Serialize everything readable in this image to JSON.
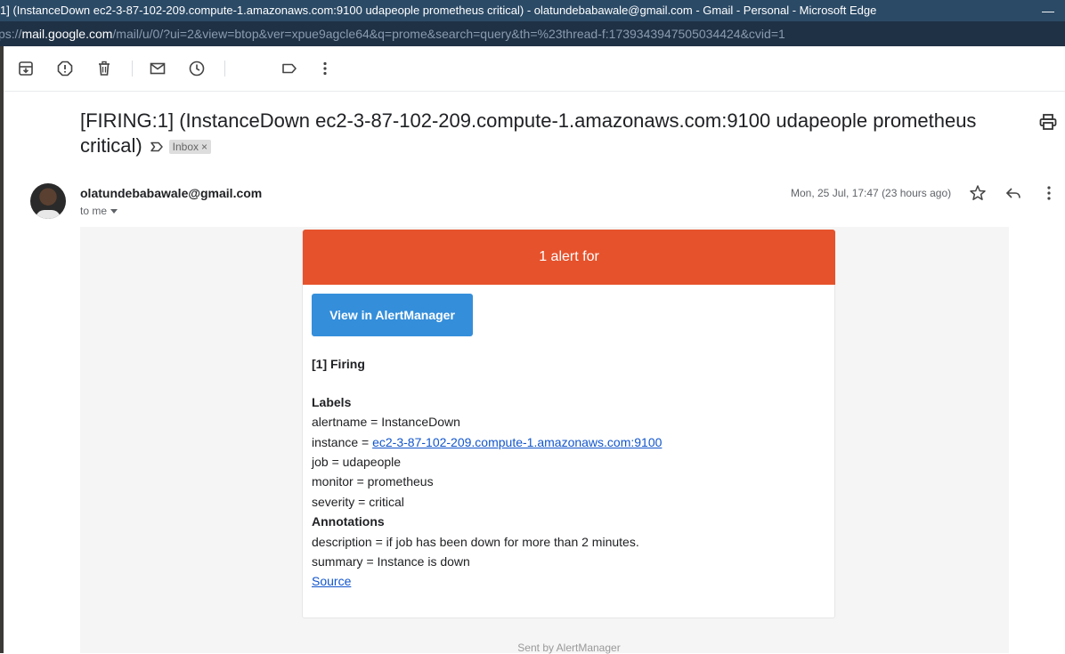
{
  "window": {
    "title": "1] (InstanceDown ec2-3-87-102-209.compute-1.amazonaws.com:9100 udapeople prometheus critical) - olatundebabawale@gmail.com - Gmail - Personal - Microsoft Edge",
    "minimize_glyph": "—"
  },
  "address": {
    "prefix": "ps://",
    "host": "mail.google.com",
    "rest": "/mail/u/0/?ui=2&view=btop&ver=xpue9agcle64&q=prome&search=query&th=%23thread-f:1739343947505034424&cvid=1"
  },
  "toolbar": {
    "icons": [
      "archive-icon",
      "report-spam-icon",
      "delete-icon",
      "mark-unread-icon",
      "snooze-icon",
      "label-icon",
      "more-vert-icon"
    ]
  },
  "email": {
    "subject": "[FIRING:1] (InstanceDown ec2-3-87-102-209.compute-1.amazonaws.com:9100 udapeople prometheus critical)",
    "inbox_chip": "Inbox",
    "inbox_chip_close": "×",
    "sender": "olatundebabawale@gmail.com",
    "to": "to me",
    "date": "Mon, 25 Jul, 17:47 (23 hours ago)"
  },
  "body": {
    "header": "1 alert for",
    "button": "View in AlertManager",
    "firing": "[1] Firing",
    "labels_heading": "Labels",
    "alertname": "alertname = InstanceDown",
    "instance_prefix": "instance = ",
    "instance_link": "ec2-3-87-102-209.compute-1.amazonaws.com:9100",
    "job": "job = udapeople",
    "monitor": "monitor = prometheus",
    "severity": "severity = critical",
    "annotations_heading": "Annotations",
    "description": "description = if job has been down for more than 2 minutes.",
    "summary": "summary = Instance is down",
    "source": "Source",
    "footer": "Sent by AlertManager"
  },
  "colors": {
    "alert_header": "#e6522c",
    "button": "#348eda",
    "link": "#1155cc",
    "titlebar": "#2b4a66"
  }
}
